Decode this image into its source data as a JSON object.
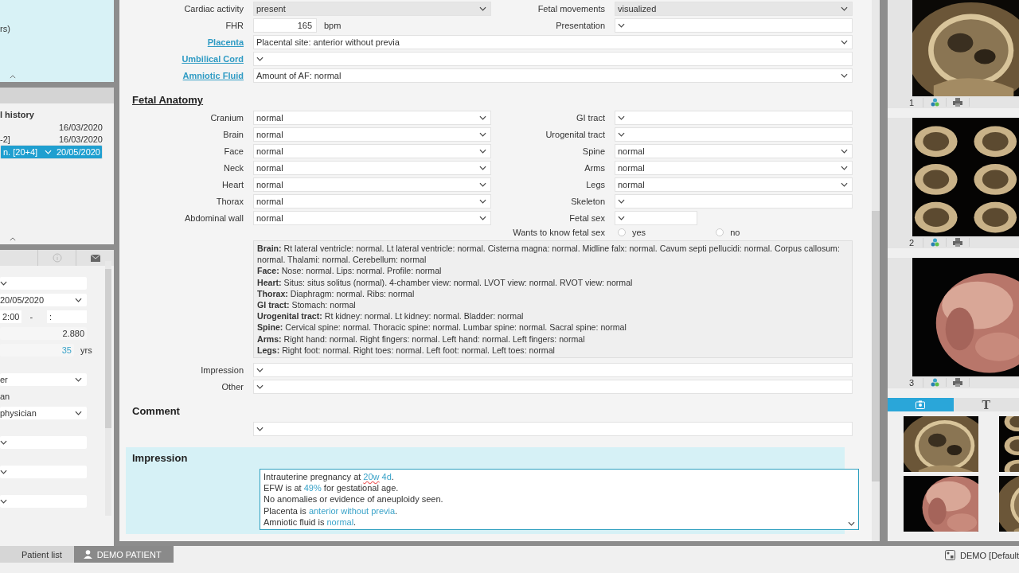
{
  "left_panel": {
    "top_box": {
      "text": "rs)"
    },
    "history": {
      "title": "l history",
      "items": [
        {
          "date": "16/03/2020",
          "selected": false
        },
        {
          "label": "-2]",
          "date": "16/03/2020",
          "selected": false
        },
        {
          "label": "n. [20+4]",
          "date": "20/05/2020",
          "selected": true
        }
      ]
    },
    "form_groups": [
      [
        {
          "kind": "select"
        },
        {
          "kind": "select",
          "value": "20/05/2020"
        },
        {
          "kind": "time",
          "value": "2:00",
          "separator": "-",
          "end": ":"
        },
        {
          "kind": "number",
          "value": "2.880"
        },
        {
          "kind": "age",
          "value": "35",
          "unit": "yrs"
        }
      ],
      [
        {
          "kind": "select",
          "value": "er"
        },
        {
          "kind": "text",
          "value": "an"
        },
        {
          "kind": "select",
          "value": "physician"
        }
      ],
      [
        {
          "kind": "select"
        }
      ],
      [
        {
          "kind": "select"
        }
      ],
      [
        {
          "kind": "select"
        }
      ]
    ]
  },
  "exam_form": {
    "sections": [
      {
        "kind": "fields",
        "rows": [
          [
            {
              "kind": "select",
              "label": "Cardiac activity",
              "value": "present",
              "disabled": true
            },
            {
              "kind": "select",
              "label": "Fetal movements",
              "value": "visualized",
              "disabled": true
            }
          ],
          [
            {
              "kind": "number",
              "label": "FHR",
              "value": "165",
              "unit": "bpm"
            },
            {
              "kind": "select",
              "label": "Presentation"
            }
          ],
          [
            {
              "kind": "wide",
              "label": "Placenta",
              "link": true,
              "value": "Placental site: anterior without previa"
            }
          ],
          [
            {
              "kind": "wide",
              "label": "Umbilical Cord",
              "link": true
            }
          ],
          [
            {
              "kind": "wide",
              "label": "Amniotic Fluid",
              "link": true,
              "value": "Amount of AF: normal"
            }
          ]
        ]
      },
      {
        "kind": "heading",
        "text": "Fetal Anatomy",
        "underlined": true
      },
      {
        "kind": "fields",
        "rows": [
          [
            {
              "kind": "select",
              "label": "Cranium",
              "value": "normal"
            },
            {
              "kind": "select",
              "label": "GI tract"
            }
          ],
          [
            {
              "kind": "select",
              "label": "Brain",
              "value": "normal"
            },
            {
              "kind": "select",
              "label": "Urogenital tract"
            }
          ],
          [
            {
              "kind": "select",
              "label": "Face",
              "value": "normal"
            },
            {
              "kind": "select",
              "label": "Spine",
              "value": "normal"
            }
          ],
          [
            {
              "kind": "select",
              "label": "Neck",
              "value": "normal"
            },
            {
              "kind": "select",
              "label": "Arms",
              "value": "normal"
            }
          ],
          [
            {
              "kind": "select",
              "label": "Heart",
              "value": "normal"
            },
            {
              "kind": "select",
              "label": "Legs",
              "value": "normal"
            }
          ],
          [
            {
              "kind": "select",
              "label": "Thorax",
              "value": "normal"
            },
            {
              "kind": "select",
              "label": "Skeleton"
            }
          ],
          [
            {
              "kind": "select",
              "label": "Abdominal wall",
              "value": "normal"
            },
            {
              "kind": "short",
              "label": "Fetal sex"
            }
          ],
          [
            "",
            {
              "kind": "radio",
              "label": "Wants to know fetal sex",
              "options": [
                {
                  "label": "yes",
                  "selected": false
                },
                {
                  "label": "no",
                  "selected": false
                }
              ]
            }
          ]
        ]
      },
      {
        "kind": "summary",
        "lines": [
          "**Brain:** Rt lateral ventricle: normal. Lt lateral ventricle: normal. Cisterna magna: normal. Midline falx: normal. Cavum septi pellucidi: normal. Corpus callosum: normal. Thalami: normal. Cerebellum: normal",
          "**Face:** Nose: normal. Lips: normal. Profile: normal",
          "**Heart:** Situs: situs solitus (normal). 4-chamber view: normal. LVOT view: normal. RVOT view: normal",
          "**Thorax:** Diaphragm: normal. Ribs: normal",
          "**GI tract:** Stomach: normal",
          "**Urogenital tract:** Rt kidney: normal. Lt kidney: normal. Bladder: normal",
          "**Spine:** Cervical spine: normal. Thoracic spine: normal. Lumbar spine: normal. Sacral spine: normal",
          "**Arms:** Right hand: normal. Right fingers: normal. Left hand: normal. Left fingers: normal",
          "**Legs:** Right foot: normal. Right toes: normal. Left foot: normal. Left toes: normal"
        ]
      },
      {
        "kind": "fields",
        "rows": [
          [
            {
              "kind": "wide",
              "label": "Impression"
            }
          ],
          [
            {
              "kind": "wide",
              "label": "Other"
            }
          ]
        ]
      },
      {
        "kind": "heading",
        "text": "Comment",
        "underlined": false
      },
      {
        "kind": "fields",
        "rows": [
          [
            {
              "kind": "wide"
            }
          ]
        ]
      },
      {
        "kind": "panel",
        "title": "Impression",
        "lines": [
          [
            {
              "text": "Intrauterine pregnancy at "
            },
            {
              "text": "20w",
              "highlight": true,
              "misspelled": true
            },
            {
              "text": " 4d",
              "highlight": true
            },
            {
              "text": "."
            }
          ],
          [
            {
              "text": "EFW is at "
            },
            {
              "text": "49%",
              "highlight": true
            },
            {
              "text": " for gestational age."
            }
          ],
          [
            {
              "text": "No anomalies or evidence of aneuploidy seen."
            }
          ],
          [
            {
              "text": "Placenta is "
            },
            {
              "text": "anterior without previa",
              "highlight": true
            },
            {
              "text": "."
            }
          ],
          [
            {
              "text": "Amniotic fluid is "
            },
            {
              "text": "normal",
              "highlight": true
            },
            {
              "text": "."
            }
          ]
        ]
      }
    ]
  },
  "image_panel": {
    "images": [
      {
        "number": "1",
        "kind": "picture"
      },
      {
        "number": "2",
        "kind": "picture"
      },
      {
        "number": "3",
        "kind": "picture"
      }
    ],
    "tabs": [
      {
        "kind": "camera",
        "selected": true
      },
      {
        "kind": "text",
        "label": "T",
        "selected": false
      }
    ]
  },
  "bottom_bar": {
    "tabs": [
      {
        "label": "Patient list",
        "selected": false,
        "icon": false
      },
      {
        "label": "DEMO PATIENT",
        "selected": true,
        "icon": true
      }
    ],
    "status": "DEMO [Default"
  }
}
